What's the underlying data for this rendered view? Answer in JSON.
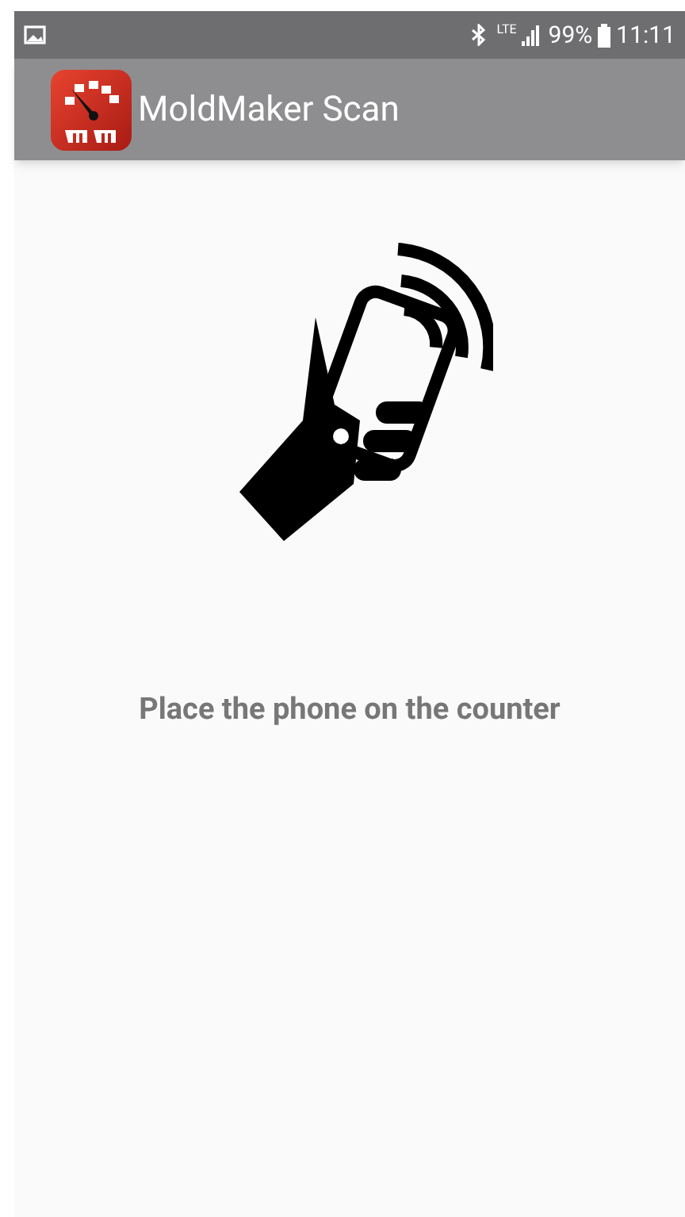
{
  "status_bar": {
    "network": "LTE",
    "battery": "99%",
    "time": "11:11"
  },
  "app_bar": {
    "title": "MoldMaker Scan"
  },
  "message": "Place the phone on the counter"
}
